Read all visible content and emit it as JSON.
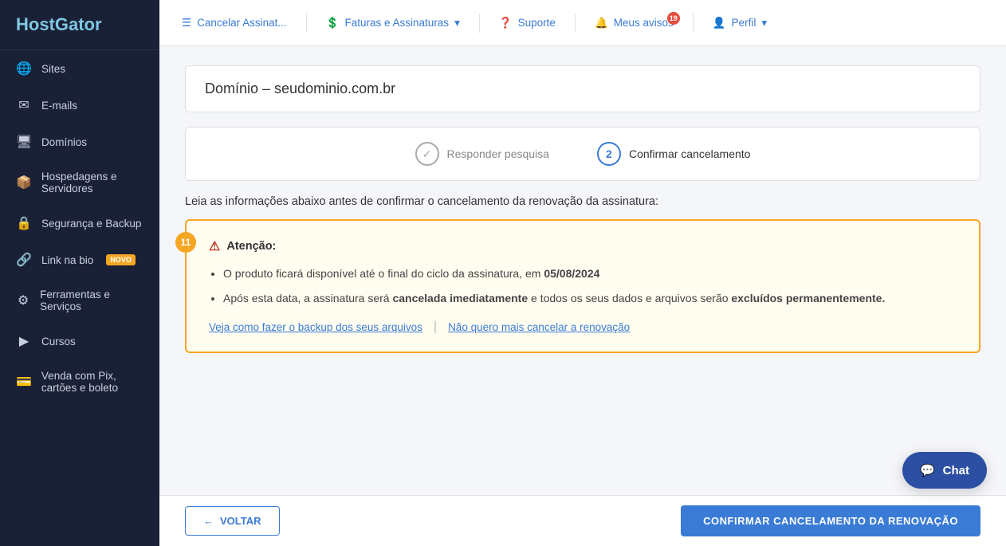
{
  "sidebar": {
    "logo": "HostGator",
    "items": [
      {
        "id": "sites",
        "label": "Sites",
        "icon": "🌐"
      },
      {
        "id": "emails",
        "label": "E-mails",
        "icon": "✉"
      },
      {
        "id": "dominios",
        "label": "Domínios",
        "icon": "🖥"
      },
      {
        "id": "hospedagens",
        "label": "Hospedagens e Servidores",
        "icon": "📦"
      },
      {
        "id": "seguranca",
        "label": "Segurança e Backup",
        "icon": "🔒"
      },
      {
        "id": "linkbio",
        "label": "Link na bio",
        "icon": "🔗",
        "badge": "NOVO"
      },
      {
        "id": "ferramentas",
        "label": "Ferramentas e Serviços",
        "icon": "⚙"
      },
      {
        "id": "cursos",
        "label": "Cursos",
        "icon": "▶"
      },
      {
        "id": "vendapix",
        "label": "Venda com Pix, cartões e boleto",
        "icon": "💳"
      }
    ]
  },
  "topnav": {
    "cancel_label": "Cancelar Assinat...",
    "billing_label": "Faturas e Assinaturas",
    "support_label": "Suporte",
    "notifications_label": "Meus avisos",
    "notification_count": "19",
    "profile_label": "Perfil"
  },
  "domain": {
    "title": "Domínio – seudominio.com.br"
  },
  "steps": [
    {
      "id": "step1",
      "label": "Responder pesquisa",
      "state": "done",
      "number": "✓"
    },
    {
      "id": "step2",
      "label": "Confirmar cancelamento",
      "state": "active",
      "number": "2"
    }
  ],
  "main": {
    "intro_text": "Leia as informações abaixo antes de confirmar o cancelamento da renovação da assinatura:",
    "warning": {
      "title": "Atenção:",
      "step_badge": "11",
      "bullet1_prefix": "O produto ficará disponível até o final do ciclo da assinatura, em ",
      "bullet1_date": "05/08/2024",
      "bullet2_pre": "Após esta data, a assinatura será ",
      "bullet2_bold1": "cancelada imediatamente",
      "bullet2_mid": " e todos os seus dados e arquivos serão ",
      "bullet2_bold2": "excluídos permanentemente.",
      "link1": "Veja como fazer o backup dos seus arquivos",
      "link2": "Não quero mais cancelar a renovação"
    }
  },
  "footer": {
    "back_label": "VOLTAR",
    "confirm_label": "CONFIRMAR CANCELAMENTO DA RENOVAÇÃO"
  },
  "chat": {
    "label": "Chat"
  }
}
